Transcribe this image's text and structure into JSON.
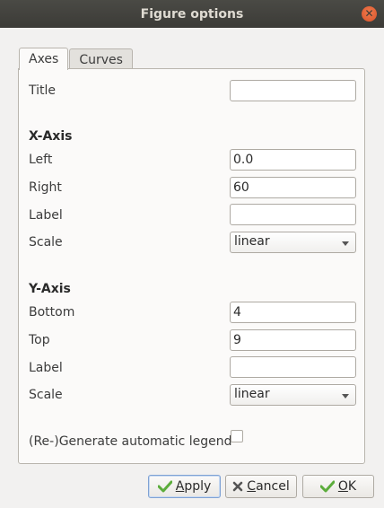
{
  "window": {
    "title": "Figure options"
  },
  "tabs": [
    {
      "label": "Axes",
      "active": true
    },
    {
      "label": "Curves",
      "active": false
    }
  ],
  "axes": {
    "title_label": "Title",
    "title_value": "",
    "x_axis": {
      "heading": "X-Axis",
      "left_label": "Left",
      "left_value": "0.0",
      "right_label": "Right",
      "right_value": "60",
      "label_label": "Label",
      "label_value": "",
      "scale_label": "Scale",
      "scale_value": "linear"
    },
    "y_axis": {
      "heading": "Y-Axis",
      "bottom_label": "Bottom",
      "bottom_value": "4",
      "top_label": "Top",
      "top_value": "9",
      "label_label": "Label",
      "label_value": "",
      "scale_label": "Scale",
      "scale_value": "linear"
    },
    "legend_label": "(Re-)Generate automatic legend",
    "legend_checked": false
  },
  "buttons": {
    "apply": {
      "prefix": "",
      "mnemonic": "A",
      "rest": "pply"
    },
    "cancel": {
      "prefix": "",
      "mnemonic": "C",
      "rest": "ancel"
    },
    "ok": {
      "prefix": "",
      "mnemonic": "O",
      "rest": "K"
    }
  },
  "colors": {
    "titlebar": "#3c3b37",
    "close": "#e2562b",
    "check_icon": "#5cad3c",
    "cancel_icon": "#555555"
  },
  "icons": {
    "close": "close-icon",
    "apply": "check-icon",
    "cancel": "x-icon",
    "ok": "check-icon"
  }
}
